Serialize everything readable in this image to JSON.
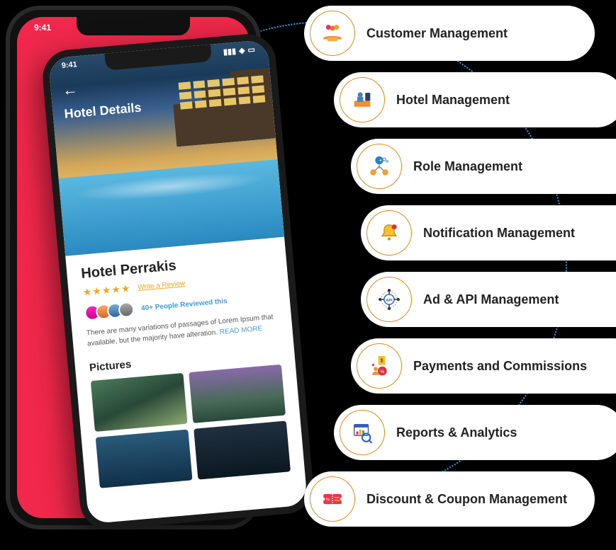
{
  "status_time": "9:41",
  "page_title": "Hotel Details",
  "hotel_name": "Hotel Perrakis",
  "stars": "★★★★★",
  "write_review": "Write a Review",
  "reviews_count": "40+ People Reviewed this",
  "description": "There are many variations of passages of Lorem Ipsum that available, but the majority have alteration. ",
  "read_more": "READ MORE",
  "pictures_title": "Pictures",
  "features": [
    {
      "label": "Customer Management"
    },
    {
      "label": "Hotel Management"
    },
    {
      "label": "Role Management"
    },
    {
      "label": "Notification Management"
    },
    {
      "label": "Ad & API Management"
    },
    {
      "label": "Payments and Commissions"
    },
    {
      "label": "Reports & Analytics"
    },
    {
      "label": "Discount & Coupon Management"
    }
  ]
}
